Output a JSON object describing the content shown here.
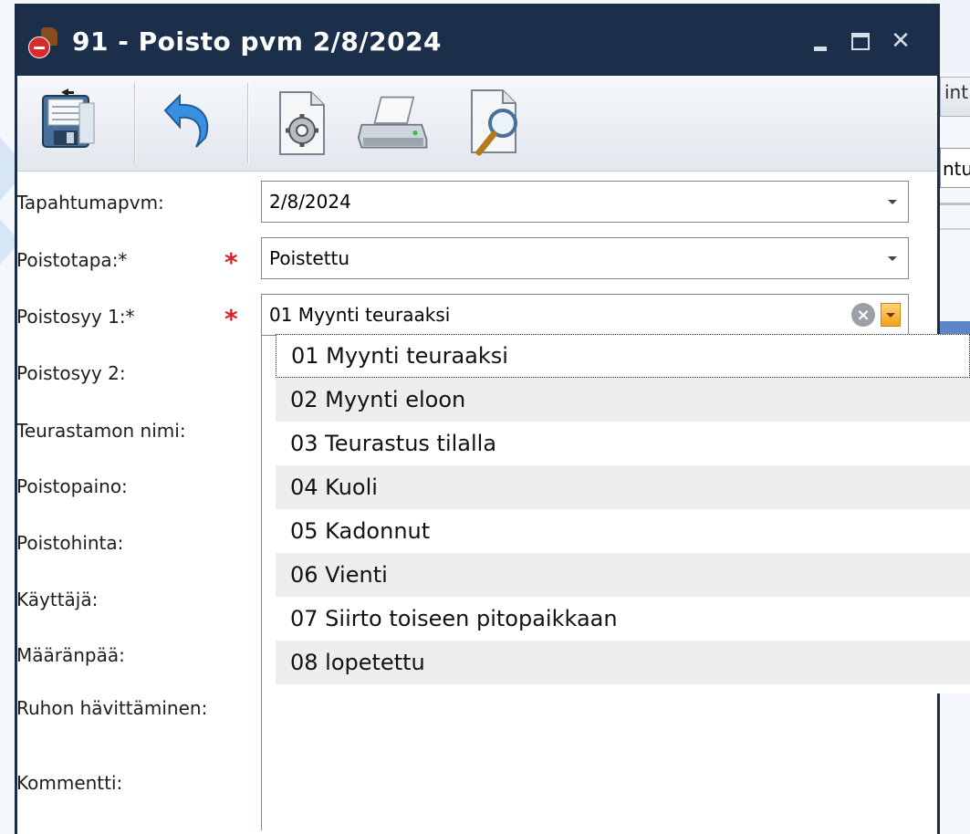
{
  "window": {
    "title": "91 - Poisto pvm 2/8/2024"
  },
  "toolbar": {
    "buttons": [
      "save-icon",
      "undo-icon",
      "settings-document-icon",
      "print-icon",
      "preview-icon"
    ]
  },
  "background": {
    "tab_fragment": "int",
    "field_fragment": "ntu"
  },
  "form": {
    "tapahtumapvm": {
      "label": "Tapahtumapvm:",
      "value": "2/8/2024"
    },
    "poistotapa": {
      "label": "Poistotapa:*",
      "value": "Poistettu",
      "required": "*"
    },
    "poistosyy1": {
      "label": "Poistosyy 1:*",
      "value": "01 Myynti teuraaksi",
      "required": "*"
    },
    "poistosyy2": {
      "label": "Poistosyy 2:"
    },
    "teurastamo": {
      "label": "Teurastamon nimi:"
    },
    "poistopaino": {
      "label": "Poistopaino:"
    },
    "poistohinta": {
      "label": "Poistohinta:"
    },
    "kayttaja": {
      "label": "Käyttäjä:"
    },
    "maaranpaa": {
      "label": "Määränpää:"
    },
    "ruhon": {
      "label": "Ruhon hävittäminen:"
    },
    "kommentti": {
      "label": "Kommentti:"
    }
  },
  "dropdown": {
    "items": [
      "01 Myynti teuraaksi",
      "02 Myynti eloon",
      "03 Teurastus tilalla",
      "04 Kuoli",
      "05 Kadonnut",
      "06 Vienti",
      "07 Siirto toiseen pitopaikkaan",
      "08 lopetettu"
    ]
  },
  "colors": {
    "titlebar": "#1b2f4b",
    "required": "#d8232a",
    "accent_orange": "#f3a21d"
  }
}
